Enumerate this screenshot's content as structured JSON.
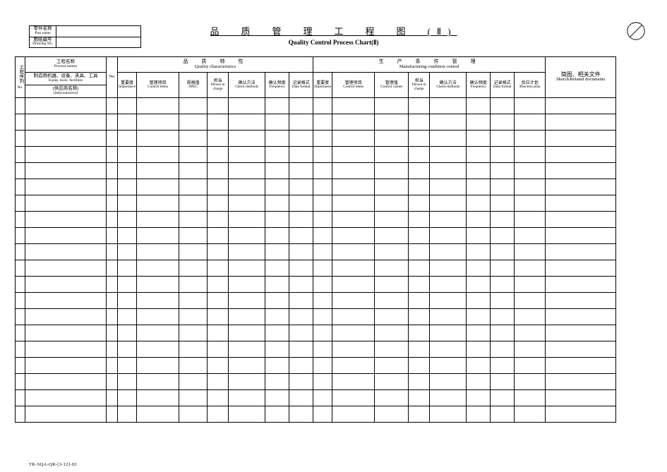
{
  "info": {
    "part_name_cn": "零件名称",
    "part_name_en": "Part name",
    "drawing_no_cn": "图纸编号",
    "drawing_no_en": "Drawing No."
  },
  "title": {
    "cn": "品　质　管　理　工　程　图　(Ⅱ)",
    "en": "Quality Control Process Chart(Ⅱ)"
  },
  "columns": {
    "seq_cn": "工程序列",
    "seq_en": "No.",
    "process_cn": "工程名称",
    "process_en": "Process names",
    "equip_cn": "制造用机器、设备、夹具、工具",
    "equip_en": "Equip. tools. facilities",
    "subcon_cn": "(供应商名称)",
    "subcon_en": "(Subcontractor)",
    "no": "No",
    "qc_cn": "品　质　特　性",
    "qc_en": "Quality characteristics",
    "mc_cn": "生　产　条　件　管　理",
    "mc_en": "Manufacturing condition control",
    "sketch_cn": "简图、相关文件",
    "sketch_en": "Sketch/Related documents",
    "imp_cn": "重要度",
    "imp_en": "Importance",
    "ci_cn": "管理项目",
    "ci_en": "Control items",
    "spec_cn": "规格值",
    "spec_en": "SPEC",
    "pic_cn": "担当",
    "pic_en": "Person in charge",
    "cm_cn": "确认方法",
    "cm_en": "Check methods",
    "freq_cn": "确认频度",
    "freq_en": "Frequency",
    "df_cn": "记录格式",
    "df_en": "Data format",
    "cv_cn": "管理值",
    "cv_en": "Control values",
    "rp_cn": "反应计划",
    "rp_en": "Reaction plan"
  },
  "footer": "TK-SQA-QR-[3-12]-02"
}
